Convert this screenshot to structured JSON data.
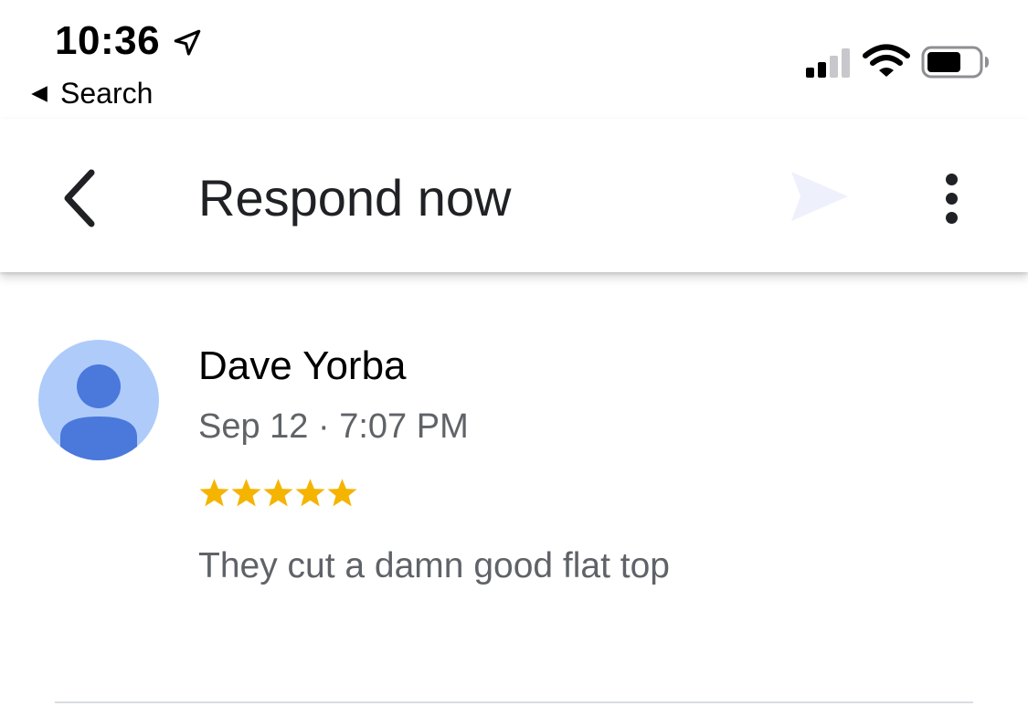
{
  "status_bar": {
    "time": "10:36",
    "back_app_label": "Search",
    "icons": [
      "location-arrow-icon",
      "signal-icon",
      "wifi-icon",
      "battery-icon"
    ]
  },
  "app_bar": {
    "title": "Respond now",
    "icons": [
      "chevron-left-icon",
      "send-icon",
      "more-vert-icon"
    ]
  },
  "review": {
    "reviewer_name": "Dave Yorba",
    "date": "Sep 12 · 7:07 PM",
    "rating": 5,
    "rating_max": 5,
    "text": "They cut a damn good flat top"
  },
  "colors": {
    "star": "#f4b400",
    "avatar_bg": "#aecbfa",
    "avatar_fg": "#4a78db",
    "send_disabled": "#eef1fc"
  }
}
